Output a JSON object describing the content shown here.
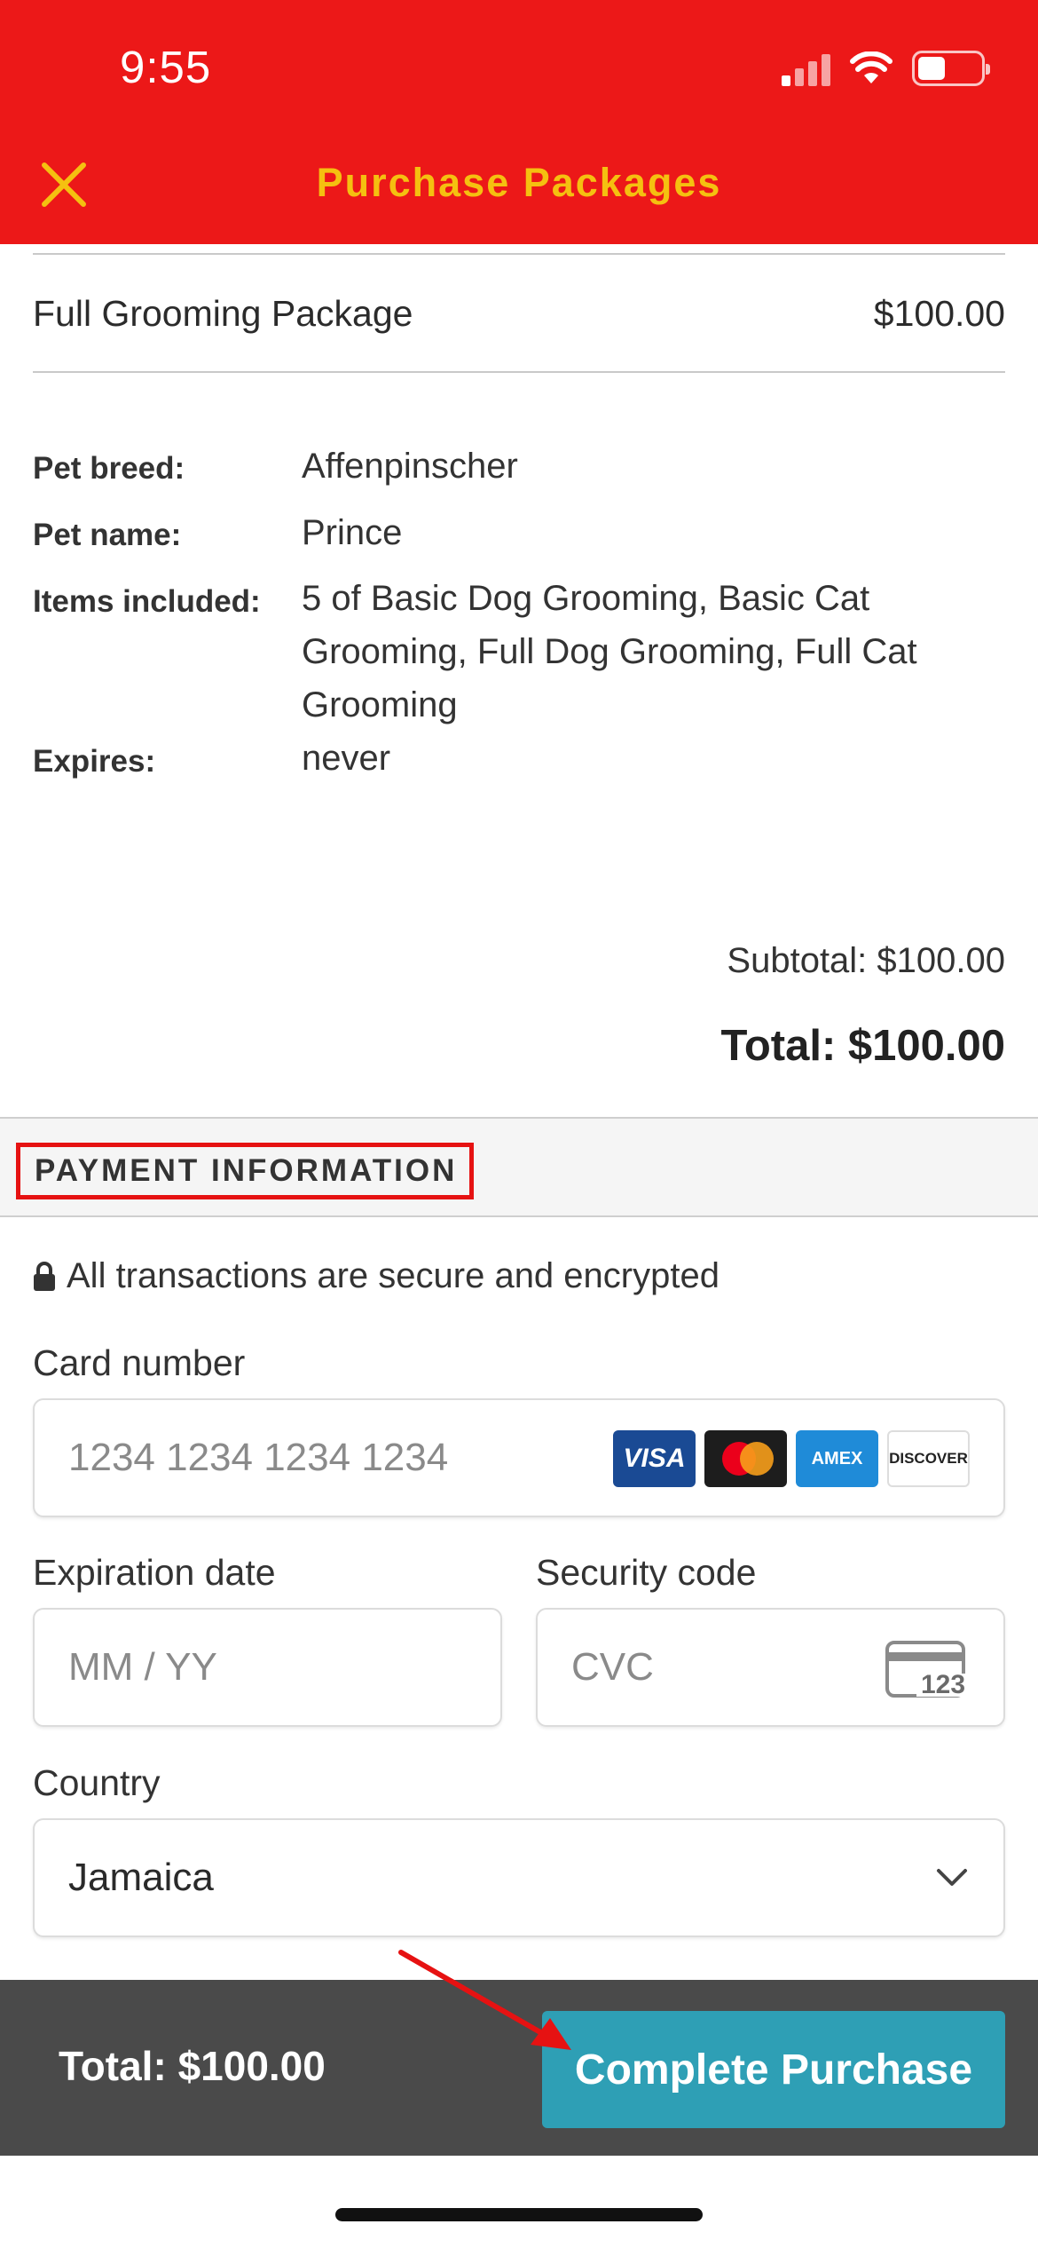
{
  "status_bar": {
    "time": "9:55"
  },
  "header": {
    "title": "Purchase Packages"
  },
  "package": {
    "name": "Full Grooming Package",
    "price": "$100.00",
    "details": [
      {
        "label": "Pet breed:",
        "value": "Affenpinscher"
      },
      {
        "label": "Pet name:",
        "value": "Prince"
      },
      {
        "label": "Items included:",
        "value": "5 of Basic Dog Grooming, Basic Cat Grooming, Full Dog Grooming, Full Cat Grooming"
      },
      {
        "label": "Expires:",
        "value": "never"
      }
    ],
    "subtotal": "Subtotal: $100.00",
    "total": "Total: $100.00"
  },
  "payment": {
    "section_title": "PAYMENT INFORMATION",
    "secure_text": "All transactions are secure and encrypted",
    "card_number": {
      "label": "Card number",
      "placeholder": "1234 1234 1234 1234"
    },
    "card_brands": [
      "VISA",
      "Mastercard",
      "AMEX",
      "DISCOVER"
    ],
    "expiration": {
      "label": "Expiration date",
      "placeholder": "MM / YY"
    },
    "security_code": {
      "label": "Security code",
      "placeholder": "CVC",
      "icon_text": "123"
    },
    "country": {
      "label": "Country",
      "value": "Jamaica"
    }
  },
  "footer": {
    "total": "Total: $100.00",
    "button_label": "Complete Purchase"
  },
  "colors": {
    "header_bg": "#ec1818",
    "header_title": "#f5c010",
    "button_bg": "#2e9fb5",
    "footer_bg": "#4a4a4a",
    "highlight": "#e61212"
  }
}
